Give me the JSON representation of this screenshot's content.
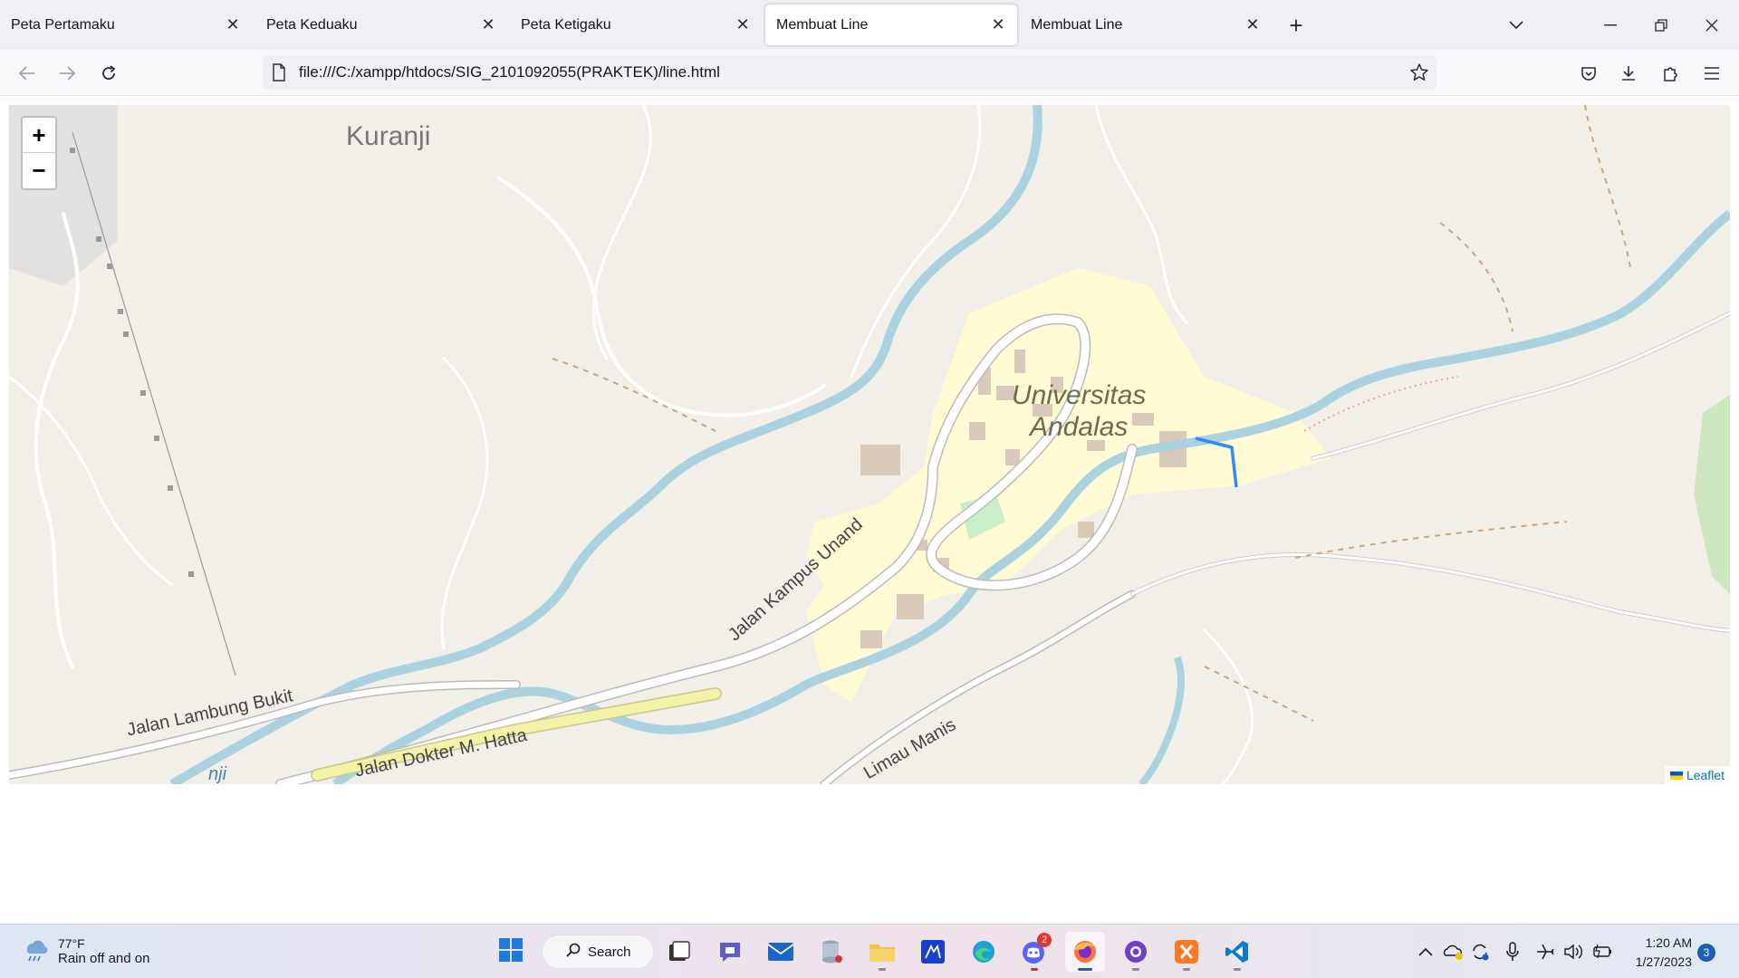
{
  "browser": {
    "tabs": [
      {
        "label": "Peta Pertamaku",
        "active": false
      },
      {
        "label": "Peta Keduaku",
        "active": false
      },
      {
        "label": "Peta Ketigaku",
        "active": false
      },
      {
        "label": "Membuat Line",
        "active": true
      },
      {
        "label": "Membuat Line",
        "active": false
      }
    ],
    "url": "file:///C:/xampp/htdocs/SIG_2101092055(PRAKTEK)/line.html"
  },
  "map": {
    "zoom_in": "+",
    "zoom_out": "−",
    "labels": {
      "kuranji": "Kuranji",
      "universitas": "Universitas",
      "andalas": "Andalas",
      "jalan_kampus": "Jalan Kampus Unand",
      "jalan_lambung": "Jalan Lambung Bukit",
      "jalan_dokter": "Jalan Dokter M. Hatta",
      "limau_manis": "Limau Manis",
      "river_fragment": "nji"
    },
    "attribution": "Leaflet",
    "line_color": "#3388ff"
  },
  "taskbar": {
    "weather_temp": "77°F",
    "weather_condition": "Rain off and on",
    "search_label": "Search",
    "discord_badge": "2",
    "time": "1:20 AM",
    "date": "1/27/2023",
    "notification_count": "3"
  }
}
